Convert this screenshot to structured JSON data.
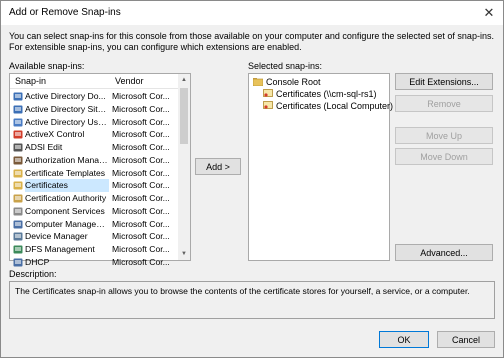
{
  "window": {
    "title": "Add or Remove Snap-ins",
    "close_glyph": "✕"
  },
  "intro_text": "You can select snap-ins for this console from those available on your computer and configure the selected set of snap-ins. For extensible snap-ins, you can configure which extensions are enabled.",
  "available": {
    "label": "Available snap-ins:",
    "col_snapin": "Snap-in",
    "col_vendor": "Vendor",
    "items": [
      {
        "name": "Active Directory Do...",
        "vendor": "Microsoft Cor...",
        "icon": "ad-domains-icon",
        "color": "#3b6fb6"
      },
      {
        "name": "Active Directory Site...",
        "vendor": "Microsoft Cor...",
        "icon": "ad-sites-icon",
        "color": "#3b6fb6"
      },
      {
        "name": "Active Directory Use...",
        "vendor": "Microsoft Cor...",
        "icon": "ad-users-icon",
        "color": "#4a7cc4"
      },
      {
        "name": "ActiveX Control",
        "vendor": "Microsoft Cor...",
        "icon": "activex-icon",
        "color": "#d23c2a"
      },
      {
        "name": "ADSI Edit",
        "vendor": "Microsoft Cor...",
        "icon": "adsi-icon",
        "color": "#555555"
      },
      {
        "name": "Authorization Manager",
        "vendor": "Microsoft Cor...",
        "icon": "authorization-icon",
        "color": "#7a5a3a"
      },
      {
        "name": "Certificate Templates",
        "vendor": "Microsoft Cor...",
        "icon": "certificate-templates-icon",
        "color": "#d9b24a"
      },
      {
        "name": "Certificates",
        "vendor": "Microsoft Cor...",
        "icon": "certificates-icon",
        "color": "#d9b24a"
      },
      {
        "name": "Certification Authority",
        "vendor": "Microsoft Cor...",
        "icon": "certification-authority-icon",
        "color": "#c9a24a"
      },
      {
        "name": "Component Services",
        "vendor": "Microsoft Cor...",
        "icon": "component-services-icon",
        "color": "#8a8a8a"
      },
      {
        "name": "Computer Managem...",
        "vendor": "Microsoft Cor...",
        "icon": "computer-management-icon",
        "color": "#4a6fa5"
      },
      {
        "name": "Device Manager",
        "vendor": "Microsoft Cor...",
        "icon": "device-manager-icon",
        "color": "#5a7a9a"
      },
      {
        "name": "DFS Management",
        "vendor": "Microsoft Cor...",
        "icon": "dfs-icon",
        "color": "#3b8a5a"
      },
      {
        "name": "DHCP",
        "vendor": "Microsoft Cor...",
        "icon": "dhcp-icon",
        "color": "#4a6fa5"
      }
    ],
    "selected_index": 7
  },
  "add_button": "Add >",
  "selected": {
    "label": "Selected snap-ins:",
    "root": "Console Root",
    "children": [
      "Certificates (\\\\cm-sql-rs1)",
      "Certificates (Local Computer)"
    ]
  },
  "side_buttons": {
    "edit_extensions": "Edit Extensions...",
    "remove": "Remove",
    "move_up": "Move Up",
    "move_down": "Move Down",
    "advanced": "Advanced..."
  },
  "description": {
    "label": "Description:",
    "text": "The Certificates snap-in allows you to browse the contents of the certificate stores for yourself, a service, or a computer."
  },
  "footer": {
    "ok": "OK",
    "cancel": "Cancel"
  },
  "colors": {
    "accent": "#0078d7",
    "selection": "#cce8ff",
    "folder": "#e8c25a"
  }
}
